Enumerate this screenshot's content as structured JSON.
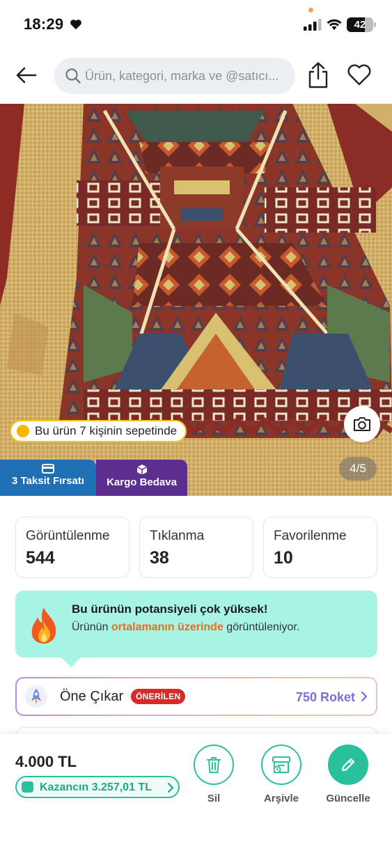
{
  "status_bar": {
    "time": "18:29",
    "battery": "42"
  },
  "header": {
    "search_placeholder": "Ürün, kategori, marka ve @satıcı..."
  },
  "gallery": {
    "basket_text": "Bu ürün 7 kişinin sepetinde",
    "counter": "4/5",
    "tags": {
      "installment": "3 Taksit Fırsatı",
      "shipping": "Kargo Bedava"
    }
  },
  "stats": [
    {
      "label": "Görüntülenme",
      "value": "544"
    },
    {
      "label": "Tıklanma",
      "value": "38"
    },
    {
      "label": "Favorilenme",
      "value": "10"
    }
  ],
  "potential": {
    "title": "Bu ürünün potansiyeli çok yüksek!",
    "desc_before": "Ürünün ",
    "desc_highlight": "ortalamanın üzerinde",
    "desc_after": " görüntüleniyor."
  },
  "promote": {
    "title": "Öne Çıkar",
    "badge": "ÖNERİLEN",
    "price": "750 Roket"
  },
  "bottom_bar": {
    "price": "4.000 TL",
    "earning": "Kazancın 3.257,01 TL",
    "actions": {
      "delete": "Sil",
      "archive": "Arşivle",
      "update": "Güncelle"
    }
  },
  "colors": {
    "accent_green": "#29c19c",
    "potential_bg": "#a7f3e4",
    "highlight_orange": "#f26a1b",
    "badge_red": "#d42a2a",
    "roket_purple": "#7b6fd6",
    "taksit_blue": "#1f6fb5",
    "kargo_purple": "#5b2e8f"
  }
}
